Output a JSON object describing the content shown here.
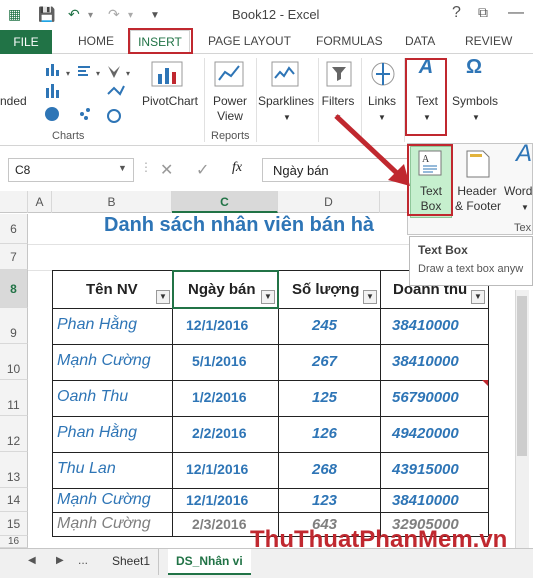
{
  "window": {
    "title": "Book12 - Excel"
  },
  "quick_access": {
    "save_icon": "save-icon",
    "undo_icon": "undo-icon",
    "redo_icon": "redo-icon",
    "customize_icon": "customize-icon"
  },
  "window_controls": {
    "help": "?",
    "restore": "restore-icon",
    "minimize": "minimize-icon"
  },
  "tabs": [
    "FILE",
    "HOME",
    "INSERT",
    "PAGE LAYOUT",
    "FORMULAS",
    "DATA",
    "REVIEW"
  ],
  "ribbon": {
    "left_clip_label": "nded",
    "pivotchart": "PivotChart",
    "power_view_1": "Power",
    "power_view_2": "View",
    "sparklines": "Sparklines",
    "filters": "Filters",
    "links": "Links",
    "text": "Text",
    "symbols": "Symbols",
    "group_charts": "Charts",
    "group_reports": "Reports"
  },
  "text_panel": {
    "textbox_1": "Text",
    "textbox_2": "Box",
    "header_1": "Header",
    "header_2": "& Footer",
    "wordart": "Word",
    "group_clip": "Tex"
  },
  "tooltip": {
    "title": "Text Box",
    "desc": "Draw a text box anyw"
  },
  "formula_bar": {
    "name_box": "C8",
    "fx_label": "fx",
    "value": "Ngày bán"
  },
  "columns": [
    "A",
    "B",
    "C",
    "D"
  ],
  "rows": [
    "6",
    "7",
    "8",
    "9",
    "10",
    "11",
    "12",
    "13",
    "14",
    "15",
    "16"
  ],
  "sheet": {
    "title": "Danh sách nhân viên bán hà",
    "headers": [
      "Tên NV",
      "Ngày bán",
      "Số lượng",
      "Doanh thu"
    ],
    "data": [
      [
        "Phan Hằng",
        "12/1/2016",
        "245",
        "38410000"
      ],
      [
        "Mạnh Cường",
        "5/1/2016",
        "267",
        "38410000"
      ],
      [
        "Oanh Thu",
        "1/2/2016",
        "125",
        "56790000"
      ],
      [
        "Phan Hằng",
        "2/2/2016",
        "126",
        "49420000"
      ],
      [
        "Thu Lan",
        "12/1/2016",
        "268",
        "43915000"
      ],
      [
        "Mạnh Cường",
        "12/1/2016",
        "123",
        "38410000"
      ],
      [
        "Mạnh Cường",
        "2/3/2016",
        "643",
        "32905000"
      ]
    ]
  },
  "sheet_tabs": {
    "sheet1": "Sheet1",
    "active": "DS_Nhân vi",
    "ellipsis": "..."
  },
  "watermark": "ThuThuatPhanMem.vn",
  "colors": {
    "excel_green": "#217346",
    "highlight_red": "#c0282f",
    "title_blue": "#2e75b6"
  }
}
